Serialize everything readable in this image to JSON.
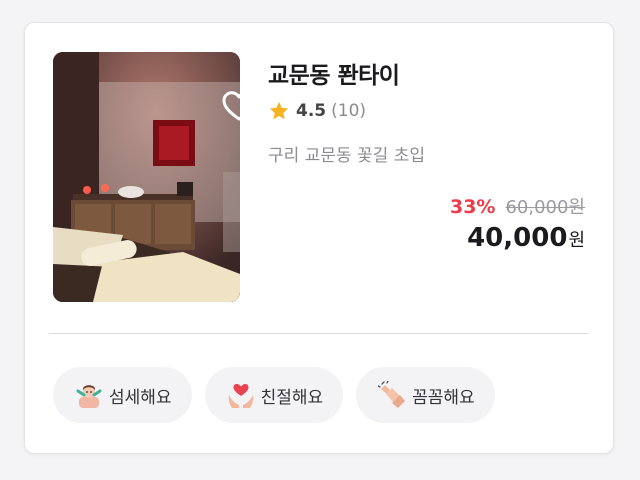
{
  "listing": {
    "name": "교문동 퐌타이",
    "rating": "4.5",
    "review_count": "(10)",
    "address": "구리 교문동 꽃길 초입",
    "discount": "33%",
    "original_price": "60,000원",
    "price": "40,000",
    "currency": "원"
  },
  "tags": [
    {
      "label": "섬세해요",
      "icon": "detailed-person-icon"
    },
    {
      "label": "친절해요",
      "icon": "hands-heart-icon"
    },
    {
      "label": "꼼꼼해요",
      "icon": "massage-hands-icon"
    }
  ],
  "colors": {
    "discount": "#ee3b4a",
    "star": "#f7b21e",
    "tag_bg": "#f3f3f6"
  }
}
